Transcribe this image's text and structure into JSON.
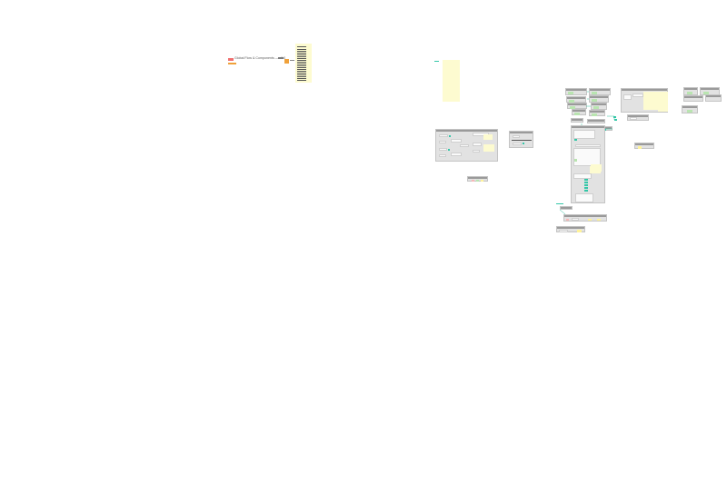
{
  "canvas": {
    "background": "#ffffff",
    "colors": {
      "group": "#e2e2e2",
      "note": "#fdfbd0",
      "accent_teal": "#34c7a8",
      "accent_orange": "#f0a13a",
      "node": "#fafafa"
    }
  },
  "title_node": {
    "text": "Global Flow & Components — v1.0",
    "icon": "flow-icon"
  }
}
